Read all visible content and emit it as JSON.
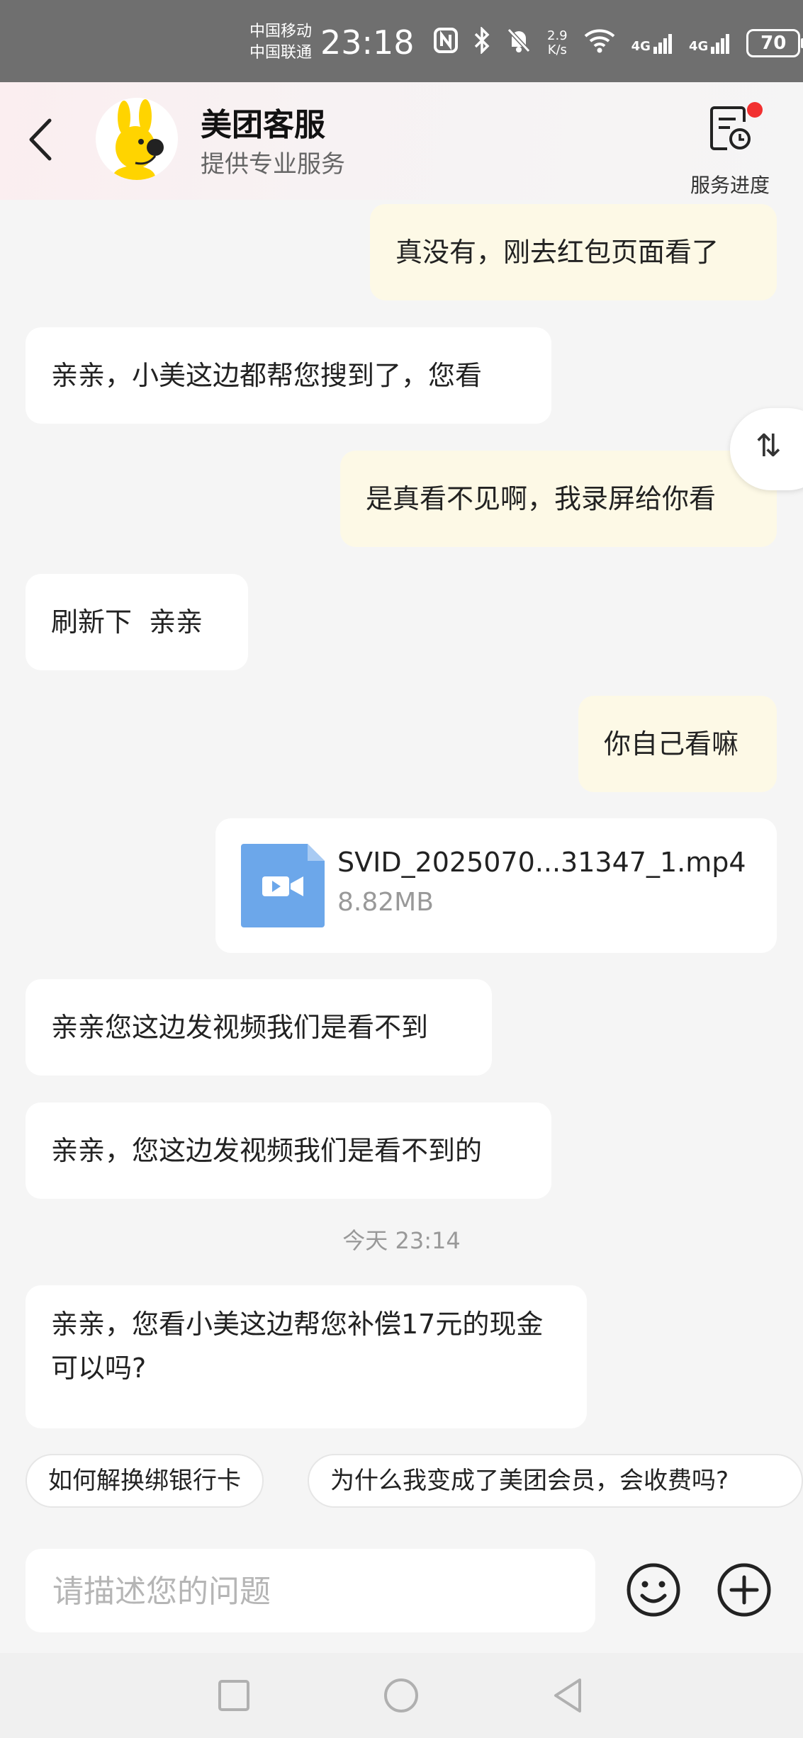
{
  "status_bar": {
    "carrier_1": "中国移动",
    "carrier_2": "中国联通",
    "time": "23:18",
    "speed_value": "2.9",
    "speed_unit": "K/s",
    "net_1": "4G",
    "net_2": "4G",
    "battery": "70"
  },
  "header": {
    "title": "美团客服",
    "subtitle": "提供专业服务",
    "progress_label": "服务进度",
    "accent_color": "#f23030"
  },
  "messages": [
    {
      "from": "me",
      "text": "真没有，刚去红包页面看了"
    },
    {
      "from": "them",
      "text": "亲亲，小美这边都帮您搜到了，您看"
    },
    {
      "from": "me",
      "text": "是真看不见啊，我录屏给你看"
    },
    {
      "from": "them",
      "text": "刷新下  亲亲"
    },
    {
      "from": "me",
      "text": "你自己看嘛"
    },
    {
      "from": "them",
      "text": "亲亲您这边发视频我们是看不到"
    },
    {
      "from": "them",
      "text": "亲亲，您这边发视频我们是看不到的"
    },
    {
      "from": "them",
      "text": "亲亲，您看小美这边帮您补偿17元的现金可以吗?"
    }
  ],
  "file_message": {
    "name": "SVID_2025070...31347_1.mp4",
    "size": "8.82MB",
    "icon": "video-file-icon"
  },
  "timestamp": "今天 23:14",
  "quick_replies": [
    "如何解换绑银行卡",
    "为什么我变成了美团会员，会收费吗?"
  ],
  "input": {
    "placeholder": "请描述您的问题",
    "value": ""
  },
  "colors": {
    "my_bubble": "#fdf9e6",
    "their_bubble": "#ffffff",
    "background": "#f5f5f5"
  }
}
